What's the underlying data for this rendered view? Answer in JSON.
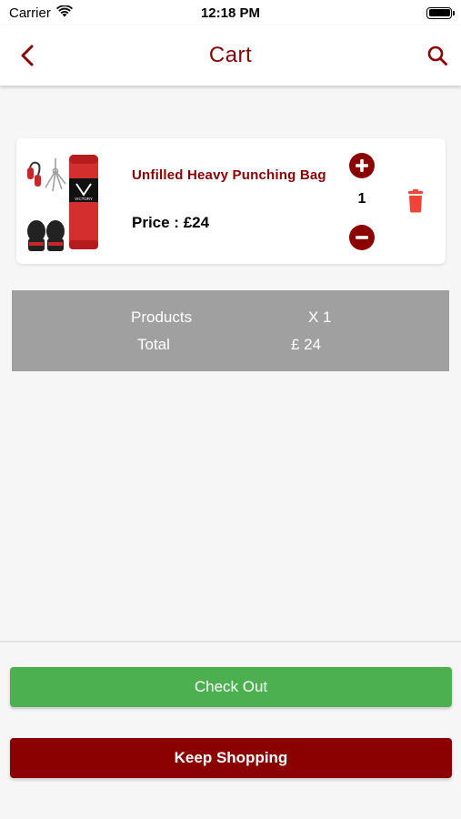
{
  "status_bar": {
    "carrier": "Carrier",
    "time": "12:18 PM"
  },
  "header": {
    "title": "Cart",
    "back_icon": "chevron-left-icon",
    "search_icon": "search-icon"
  },
  "cart": {
    "items": [
      {
        "name": "Unfilled Heavy Punching Bag",
        "price": "Price : £24",
        "quantity": "1",
        "image_brand": "VICTORY"
      }
    ]
  },
  "summary": {
    "products_label": "Products",
    "products_value": "X 1",
    "total_label": "Total",
    "total_value": "£ 24"
  },
  "actions": {
    "checkout_label": "Check Out",
    "keep_shopping_label": "Keep Shopping"
  },
  "colors": {
    "brand": "#8b0000",
    "checkout": "#4caf50",
    "delete": "#f44336",
    "summary_bg": "#a0a0a0"
  }
}
